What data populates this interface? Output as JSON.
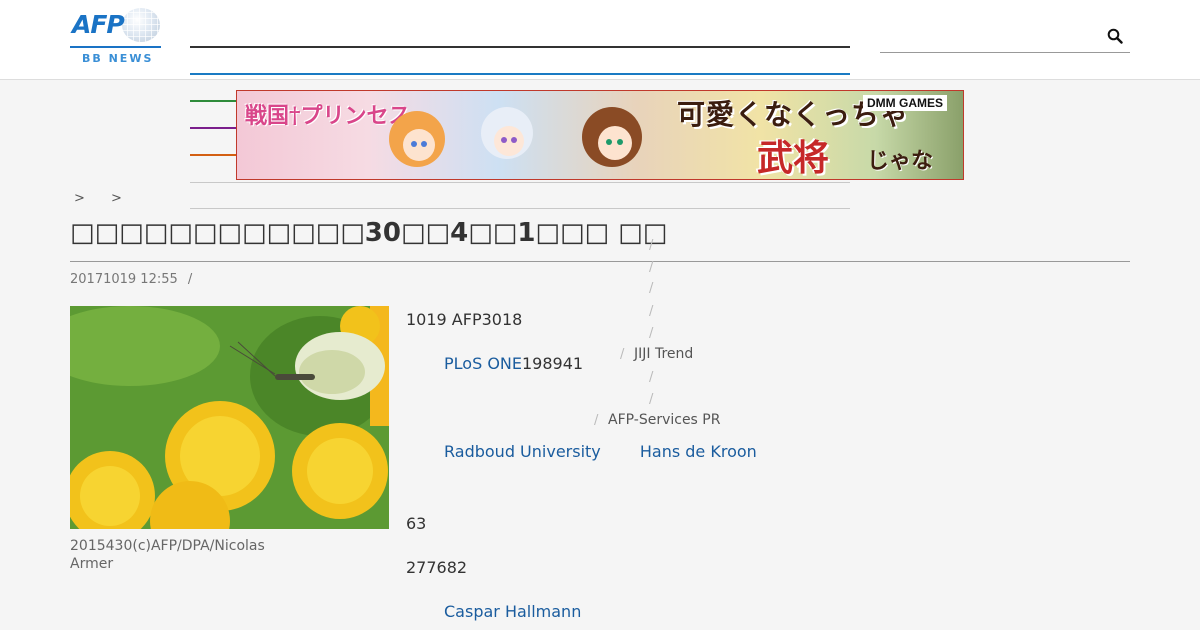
{
  "header": {
    "logo_text": "AFP",
    "logo_sub": "BB NEWS",
    "line_colors": [
      "#333333",
      "#1a7bc4"
    ]
  },
  "search": {
    "icon": "search-icon"
  },
  "nav": {
    "line_colors": [
      "#2e8b3a",
      "#7b1e8c",
      "#d35f12"
    ]
  },
  "banner": {
    "game_title": "戦国†プリンセス",
    "catch_line1": "可愛くなくっちゃ",
    "catch_line2": "武将",
    "catch_line3": "じゃない。",
    "brand": "DMM GAMES"
  },
  "breadcrumb": {
    "items": [
      ">",
      ">"
    ]
  },
  "article": {
    "title": "            30  4  1    ",
    "title_display": "□□□□□□□□□□□□30□□4□□1□□□ □□",
    "date": "20171019 12:55",
    "date_sep": "/",
    "caption": "2015430(c)AFP/DPA/Nicolas Armer",
    "p1": "1019 AFP3018",
    "p2_link": "PLoS ONE",
    "p2_text": "198941",
    "p3_link1": "Radboud University",
    "p3_link2": "Hans de Kroon",
    "p4": "63",
    "p5": "277682",
    "p6_link": "Caspar Hallmann"
  },
  "sidebar": {
    "item1": "JIJI Trend",
    "item2": "AFP-Services PR",
    "slash": "/"
  }
}
